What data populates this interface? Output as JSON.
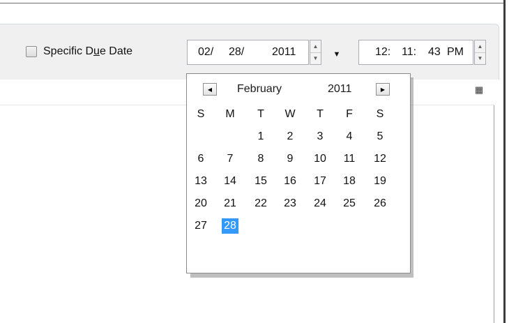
{
  "due_date": {
    "checkbox_label_pre": "Specific D",
    "checkbox_label_accel": "u",
    "checkbox_label_post": "e Date",
    "checked": false
  },
  "date_field": {
    "month": "02/",
    "day": "28/",
    "year": "2011"
  },
  "time_field": {
    "hour": "12:",
    "minute": "11:",
    "second": "43",
    "ampm": "PM"
  },
  "icons": {
    "spin_up": "▲",
    "spin_down": "▼",
    "dropdown": "▼",
    "prev_month": "◀",
    "next_month": "▶",
    "column_menu": "▦"
  },
  "calendar": {
    "month": "February",
    "year": "2011",
    "weekdays": [
      "S",
      "M",
      "T",
      "W",
      "T",
      "F",
      "S"
    ],
    "weeks": [
      [
        "",
        "",
        "1",
        "2",
        "3",
        "4",
        "5"
      ],
      [
        "6",
        "7",
        "8",
        "9",
        "10",
        "11",
        "12"
      ],
      [
        "13",
        "14",
        "15",
        "16",
        "17",
        "18",
        "19"
      ],
      [
        "20",
        "21",
        "22",
        "23",
        "24",
        "25",
        "26"
      ],
      [
        "27",
        "28",
        "",
        "",
        "",
        "",
        ""
      ]
    ],
    "selected_day": "28",
    "selected_color": "#3399ff"
  }
}
